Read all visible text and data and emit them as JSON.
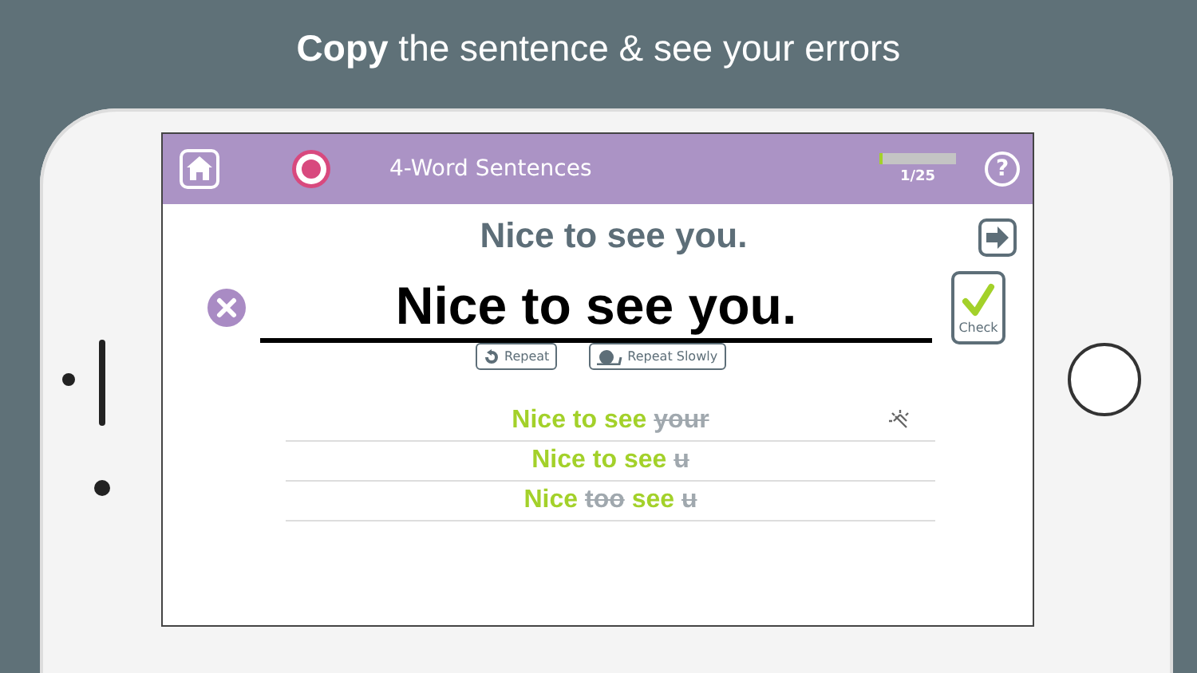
{
  "headline": "**Copy** the sentence & see your errors",
  "header": {
    "title": "4-Word Sentences",
    "progress": {
      "level": 0.04,
      "label": "1/25"
    },
    "help": "?"
  },
  "prompt": "Nice to see you.",
  "answer": {
    "value": "Nice to see you."
  },
  "check_button": "Check",
  "buttons": [
    {
      "kind": "repeat",
      "label": "Repeat"
    },
    {
      "kind": "slow",
      "label": "Repeat Slowly"
    }
  ],
  "attempts": [
    {
      "words": [
        {
          "text": "Nice",
          "correct": true
        },
        {
          "text": "to",
          "correct": true
        },
        {
          "text": "see",
          "correct": true
        },
        {
          "text": "your",
          "correct": false
        }
      ]
    },
    {
      "words": [
        {
          "text": "Nice",
          "correct": true
        },
        {
          "text": "to",
          "correct": true
        },
        {
          "text": "see",
          "correct": true
        },
        {
          "text": "u",
          "correct": false
        }
      ]
    },
    {
      "words": [
        {
          "text": "Nice",
          "correct": true
        },
        {
          "text": "too",
          "correct": false
        },
        {
          "text": "see",
          "correct": true
        },
        {
          "text": "u",
          "correct": false
        }
      ]
    }
  ]
}
